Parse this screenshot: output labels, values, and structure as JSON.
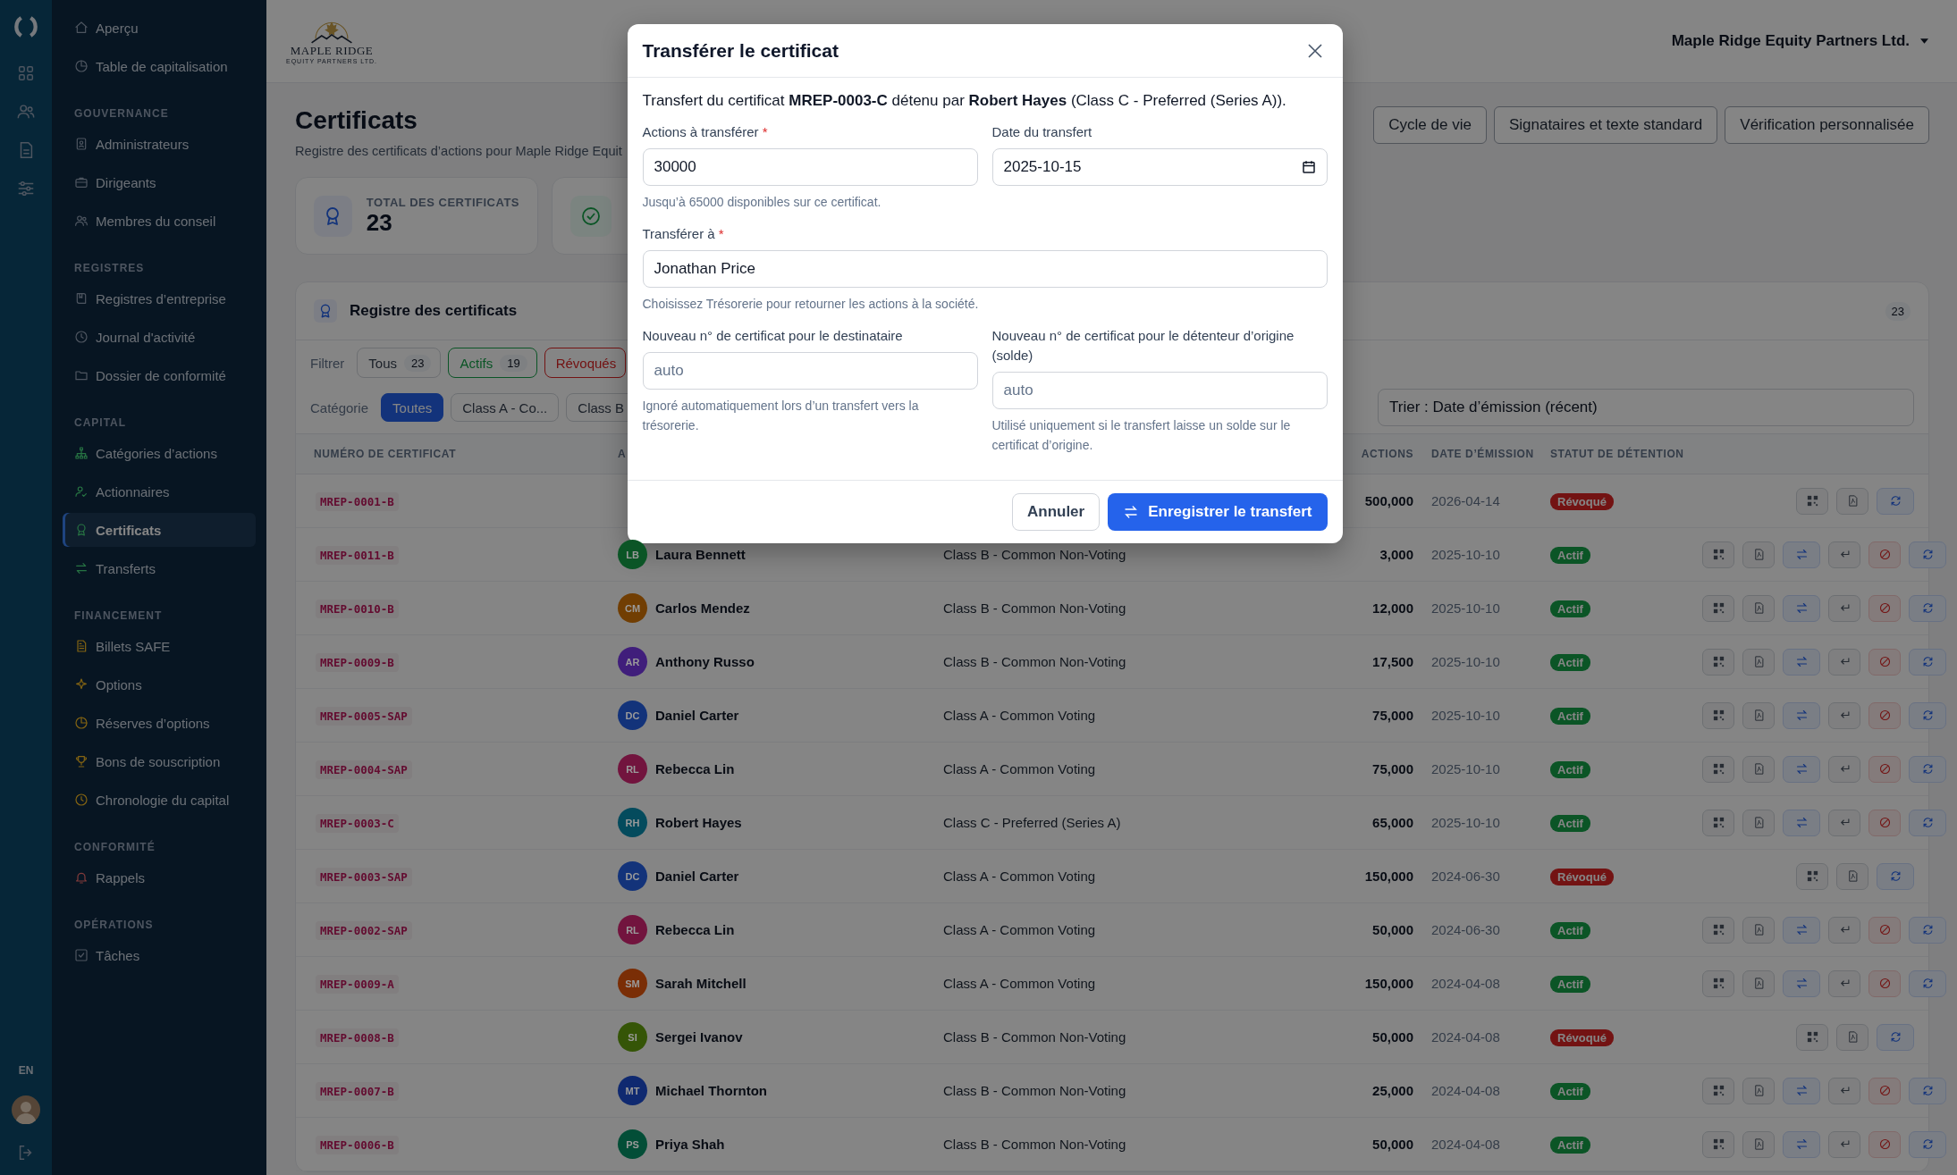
{
  "rail": {
    "language": "EN"
  },
  "sidebar": {
    "groups": [
      {
        "items": [
          {
            "label": "Aperçu",
            "selected": false
          },
          {
            "label": "Table de capitalisation",
            "selected": false
          }
        ]
      },
      {
        "title": "GOUVERNANCE",
        "items": [
          {
            "label": "Administrateurs",
            "selected": false
          },
          {
            "label": "Dirigeants",
            "selected": false
          },
          {
            "label": "Membres du conseil",
            "selected": false
          }
        ]
      },
      {
        "title": "REGISTRES",
        "items": [
          {
            "label": "Registres d’entreprise",
            "selected": false
          },
          {
            "label": "Journal d'activité",
            "selected": false
          },
          {
            "label": "Dossier de conformité",
            "selected": false
          }
        ]
      },
      {
        "title": "CAPITAL",
        "items": [
          {
            "label": "Catégories d’actions",
            "selected": false
          },
          {
            "label": "Actionnaires",
            "selected": false
          },
          {
            "label": "Certificats",
            "selected": true
          },
          {
            "label": "Transferts",
            "selected": false
          }
        ]
      },
      {
        "title": "FINANCEMENT",
        "items": [
          {
            "label": "Billets SAFE",
            "selected": false
          },
          {
            "label": "Options",
            "selected": false
          },
          {
            "label": "Réserves d’options",
            "selected": false
          },
          {
            "label": "Bons de souscription",
            "selected": false
          },
          {
            "label": "Chronologie du capital",
            "selected": false
          }
        ]
      },
      {
        "title": "CONFORMITÉ",
        "items": [
          {
            "label": "Rappels",
            "selected": false
          }
        ]
      },
      {
        "title": "OPÉRATIONS",
        "items": [
          {
            "label": "Tâches",
            "selected": false
          }
        ]
      }
    ]
  },
  "header": {
    "logo": {
      "name": "MAPLE RIDGE",
      "tagline": "EQUITY PARTNERS LTD."
    },
    "company": "Maple Ridge Equity Partners Ltd."
  },
  "page": {
    "title": "Certificats",
    "subtitle": "Registre des certificats d’actions pour Maple Ridge Equit",
    "actions": [
      "Cycle de vie",
      "Signataires et texte standard",
      "Vérification personnalisée"
    ]
  },
  "stats": [
    {
      "label": "TOTAL DES CERTIFICATS",
      "value": "23"
    }
  ],
  "register": {
    "title": "Registre des certificats",
    "count": "23",
    "filter_label": "Filtrer",
    "filters": [
      {
        "label": "Tous",
        "count": "23",
        "kind": "all"
      },
      {
        "label": "Actifs",
        "count": "19",
        "kind": "active"
      },
      {
        "label": "Révoqués",
        "kind": "revoked"
      }
    ],
    "category_label": "Catégorie",
    "categories": [
      {
        "label": "Toutes",
        "selected": true
      },
      {
        "label": "Class A - Co...",
        "selected": false
      },
      {
        "label": "Class B",
        "selected": false
      }
    ],
    "sort": "Trier : Date d’émission (récent)",
    "columns": {
      "number": "NUMÉRO DE CERTIFICAT",
      "holder": "A",
      "shares": "ACTIONS",
      "date": "DATE D’ÉMISSION",
      "status": "STATUT DE DÉTENTION"
    },
    "rows": [
      {
        "number": "MREP-0001-B",
        "shares": "500,000",
        "date": "2026-04-14",
        "status": "Révoqué",
        "revoked": true
      },
      {
        "number": "MREP-0011-B",
        "initials": "LB",
        "holder": "Laura Bennett",
        "color": "#0b5526",
        "category": "Class B - Common Non-Voting",
        "shares": "3,000",
        "date": "2025-10-10",
        "status": "Actif",
        "revoked": false
      },
      {
        "number": "MREP-0010-B",
        "initials": "CM",
        "holder": "Carlos Mendez",
        "color": "#713e03",
        "category": "Class B - Common Non-Voting",
        "shares": "12,000",
        "date": "2025-10-10",
        "status": "Actif",
        "revoked": false
      },
      {
        "number": "MREP-0009-B",
        "initials": "AR",
        "holder": "Anthony Russo",
        "color": "#401e7b",
        "category": "Class B - Common Non-Voting",
        "shares": "17,500",
        "date": "2025-10-10",
        "status": "Actif",
        "revoked": false
      },
      {
        "number": "MREP-0005-SAP",
        "initials": "DC",
        "holder": "Daniel Carter",
        "color": "#13337a",
        "category": "Class A - Common Voting",
        "shares": "75,000",
        "date": "2025-10-10",
        "status": "Actif",
        "revoked": false
      },
      {
        "number": "MREP-0004-SAP",
        "initials": "RL",
        "holder": "Rebecca Lin",
        "color": "#72143e",
        "category": "Class A - Common Voting",
        "shares": "75,000",
        "date": "2025-10-10",
        "status": "Actif",
        "revoked": false
      },
      {
        "number": "MREP-0003-C",
        "initials": "RH",
        "holder": "Robert Hayes",
        "color": "#044b5d",
        "category": "Class C - Preferred (Series A)",
        "shares": "65,000",
        "date": "2025-10-10",
        "status": "Actif",
        "revoked": false
      },
      {
        "number": "MREP-0003-SAP",
        "initials": "DC",
        "holder": "Daniel Carter",
        "color": "#13337a",
        "category": "Class A - Common Voting",
        "shares": "150,000",
        "date": "2024-06-30",
        "status": "Révoqué",
        "revoked": true
      },
      {
        "number": "MREP-0002-SAP",
        "initials": "RL",
        "holder": "Rebecca Lin",
        "color": "#72143e",
        "category": "Class A - Common Voting",
        "shares": "50,000",
        "date": "2024-06-30",
        "status": "Actif",
        "revoked": false
      },
      {
        "number": "MREP-0009-A",
        "initials": "SM",
        "holder": "Sarah Mitchell",
        "color": "#7a2e06",
        "category": "Class A - Common Voting",
        "shares": "150,000",
        "date": "2024-04-08",
        "status": "Actif",
        "revoked": false
      },
      {
        "number": "MREP-0008-B",
        "initials": "SI",
        "holder": "Sergei Ivanov",
        "color": "#355507",
        "category": "Class B - Common Non-Voting",
        "shares": "50,000",
        "date": "2024-04-08",
        "status": "Révoqué",
        "revoked": true
      },
      {
        "number": "MREP-0007-B",
        "initials": "MT",
        "holder": "Michael Thornton",
        "color": "#0f2970",
        "category": "Class B - Common Non-Voting",
        "shares": "25,000",
        "date": "2024-04-08",
        "status": "Actif",
        "revoked": false
      },
      {
        "number": "MREP-0006-B",
        "initials": "PS",
        "holder": "Priya Shah",
        "color": "#034e37",
        "category": "Class B - Common Non-Voting",
        "shares": "50,000",
        "date": "2024-04-08",
        "status": "Actif",
        "revoked": false
      }
    ]
  },
  "modal": {
    "title": "Transférer le certificat",
    "intro": "Transfert du certificat **MREP-0003-C** détenu par **Robert Hayes** (Class C - Preferred (Series A)).",
    "rows": [
      [
        {
          "kind": "text",
          "label": "Actions à transférer",
          "required_mark": "*",
          "value": "30000",
          "help": "Jusqu’à 65000 disponibles sur ce certificat."
        },
        {
          "kind": "date",
          "label": "Date du transfert",
          "value": "2025-10-15"
        }
      ],
      [
        {
          "kind": "text",
          "label": "Transférer à",
          "required_mark": "*",
          "value": "Jonathan Price",
          "help": "Choisissez Trésorerie pour retourner les actions à la société."
        }
      ],
      [
        {
          "kind": "text",
          "label": "Nouveau n° de certificat pour le destinataire",
          "placeholder": "auto",
          "help": "Ignoré automatiquement lors d’un transfert vers la trésorerie."
        },
        {
          "kind": "text",
          "label": "Nouveau n° de certificat pour le détenteur d’origine (solde)",
          "placeholder": "auto",
          "help": "Utilisé uniquement si le transfert laisse un solde sur le certificat d’origine."
        }
      ]
    ],
    "cancel": "Annuler",
    "submit": "Enregistrer le transfert"
  }
}
